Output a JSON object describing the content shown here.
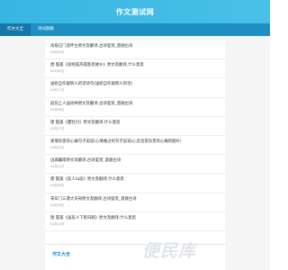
{
  "header": {
    "title": "作文测试网"
  },
  "nav": {
    "tabs": [
      {
        "label": "作文大全"
      },
      {
        "label": "诗词题解"
      }
    ]
  },
  "items": [
    {
      "title": "海角已门悲怀古原文及翻译,古诗鉴赏_意顺古诗",
      "date": "04月01日"
    },
    {
      "title": "唐 殷遥《途经孤舟孤客思故乡》原文及翻译,什么意思",
      "date": "04月05日"
    },
    {
      "title": "送给自作聪明人的话诗句(送给自作聪明人的话)",
      "date": "04月17日"
    },
    {
      "title": "庭前上人送徐林原文及翻译,古诗鉴赏_意顺古诗",
      "date": "03月08日"
    },
    {
      "title": "唐 殷遥《霍牡丹》原文及翻译,什么意思",
      "date": "03月17日"
    },
    {
      "title": "爱情伤害的心痛句子说说(心情难过的句子说说(心灵治愈伤害的心痛的图片)",
      "date": "04月02日"
    },
    {
      "title": "边城暮雨原文及翻译,古诗鉴赏_意顺古诗",
      "date": "03月21日"
    },
    {
      "title": "唐 殷遥《友人山居》原文及翻译,什么意思",
      "date": "04月08日"
    },
    {
      "title": "宋军门三遣大夫祠原文及翻译,古诗鉴赏_意顺古诗",
      "date": "04月16日"
    },
    {
      "title": "唐 殷遥《送友人下第归越》原文及翻译,什么意思",
      "date": "04月12日"
    }
  ],
  "section": {
    "title": "作文大全"
  },
  "watermark": {
    "text": "便民库"
  }
}
